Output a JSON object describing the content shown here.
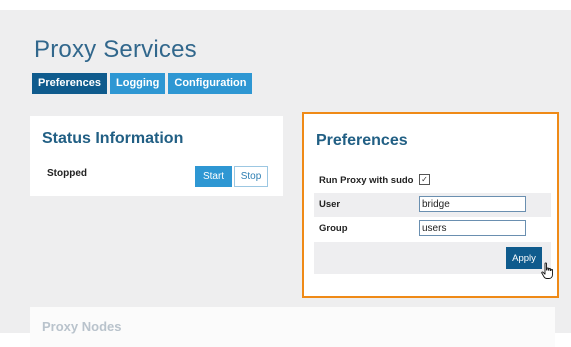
{
  "page": {
    "title": "Proxy Services"
  },
  "tabs": [
    {
      "label": "Preferences",
      "active": true
    },
    {
      "label": "Logging",
      "active": false
    },
    {
      "label": "Configuration",
      "active": false
    }
  ],
  "status_panel": {
    "title": "Status Information",
    "status": "Stopped",
    "start_label": "Start",
    "stop_label": "Stop"
  },
  "preferences_panel": {
    "title": "Preferences",
    "run_proxy_label": "Run Proxy with sudo",
    "run_proxy_checked": true,
    "user_label": "User",
    "user_value": "bridge",
    "group_label": "Group",
    "group_value": "users",
    "apply_label": "Apply"
  },
  "nodes_panel": {
    "title": "Proxy Nodes"
  },
  "colors": {
    "accent": "#2e97d3",
    "accent_dark": "#0f5b8d",
    "heading": "#215f84",
    "highlight": "#ef8a17"
  }
}
